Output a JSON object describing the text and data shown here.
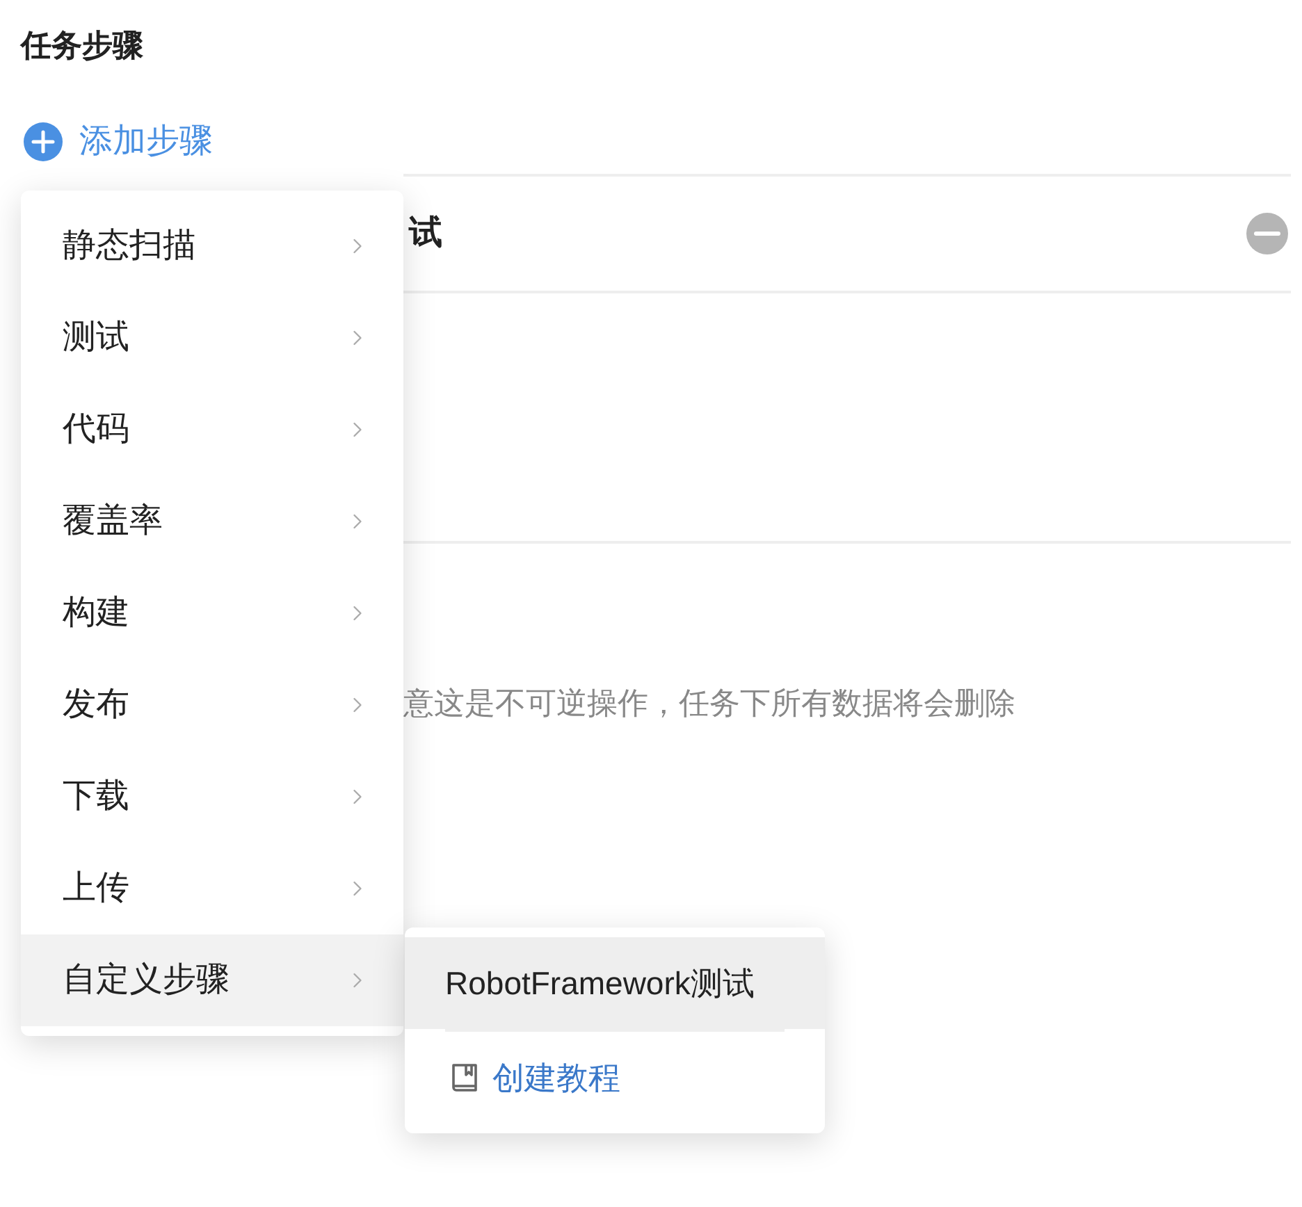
{
  "title": "任务步骤",
  "add_button": {
    "label": "添加步骤"
  },
  "step": {
    "name": "试"
  },
  "warning": "意这是不可逆操作，任务下所有数据将会删除",
  "menu": {
    "items": [
      {
        "label": "静态扫描",
        "selected": false
      },
      {
        "label": "测试",
        "selected": false
      },
      {
        "label": "代码",
        "selected": false
      },
      {
        "label": "覆盖率",
        "selected": false
      },
      {
        "label": "构建",
        "selected": false
      },
      {
        "label": "发布",
        "selected": false
      },
      {
        "label": "下载",
        "selected": false
      },
      {
        "label": "上传",
        "selected": false
      },
      {
        "label": "自定义步骤",
        "selected": true
      }
    ]
  },
  "submenu": {
    "items": [
      {
        "label": "RobotFramework测试",
        "selected": true
      }
    ],
    "link": {
      "label": "创建教程"
    }
  }
}
